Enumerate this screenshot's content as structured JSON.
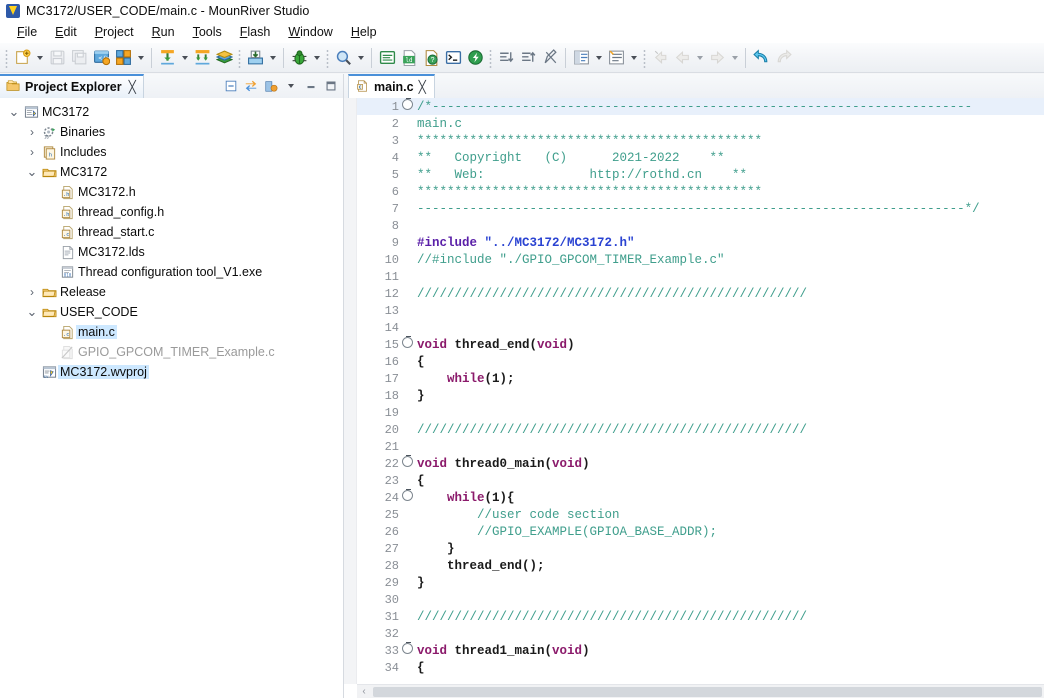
{
  "window": {
    "title": "MC3172/USER_CODE/main.c - MounRiver Studio",
    "logo_icon": "mounriver-logo-icon"
  },
  "menubar": {
    "items": [
      {
        "label": "File",
        "mnemonic": "F"
      },
      {
        "label": "Edit",
        "mnemonic": "E"
      },
      {
        "label": "Project",
        "mnemonic": "P"
      },
      {
        "label": "Run",
        "mnemonic": "R"
      },
      {
        "label": "Tools",
        "mnemonic": "T"
      },
      {
        "label": "Flash",
        "mnemonic": "F"
      },
      {
        "label": "Window",
        "mnemonic": "W"
      },
      {
        "label": "Help",
        "mnemonic": "H"
      }
    ]
  },
  "toolbar": {
    "groups": [
      {
        "buttons": [
          {
            "name": "new-button",
            "icon": "new-file-icon",
            "enabled": true,
            "dropdown": true
          },
          {
            "name": "save-button",
            "icon": "save-icon",
            "enabled": false,
            "dropdown": false
          },
          {
            "name": "save-all-button",
            "icon": "save-all-icon",
            "enabled": false,
            "dropdown": false
          },
          {
            "name": "new-project-button",
            "icon": "new-project-icon",
            "enabled": true,
            "dropdown": false
          },
          {
            "name": "build-configurations-button",
            "icon": "build-config-icon",
            "enabled": true,
            "dropdown": true
          }
        ]
      },
      {
        "buttons": [
          {
            "name": "build-button",
            "icon": "build-hammer-icon",
            "enabled": true,
            "dropdown": true
          },
          {
            "name": "build-all-button",
            "icon": "build-all-icon",
            "enabled": true,
            "dropdown": false
          },
          {
            "name": "library-button",
            "icon": "books-icon",
            "enabled": true,
            "dropdown": false
          }
        ]
      },
      {
        "buttons": [
          {
            "name": "download-button",
            "icon": "download-tray-icon",
            "enabled": true,
            "dropdown": true
          }
        ]
      },
      {
        "buttons": [
          {
            "name": "debug-button",
            "icon": "debug-bug-icon",
            "enabled": true,
            "dropdown": true
          }
        ]
      },
      {
        "buttons": [
          {
            "name": "search-button",
            "icon": "magnifier-icon",
            "enabled": true,
            "dropdown": true
          }
        ]
      },
      {
        "buttons": [
          {
            "name": "console-button",
            "icon": "console-icon",
            "enabled": true,
            "dropdown": false
          },
          {
            "name": "ld-file-button",
            "icon": "ld-file-icon",
            "enabled": true,
            "dropdown": false
          },
          {
            "name": "help-doc-button",
            "icon": "help-doc-icon",
            "enabled": true,
            "dropdown": false
          },
          {
            "name": "terminal-button",
            "icon": "terminal-icon",
            "enabled": true,
            "dropdown": false
          },
          {
            "name": "power-shell-button",
            "icon": "green-power-icon",
            "enabled": true,
            "dropdown": false
          }
        ]
      },
      {
        "buttons": [
          {
            "name": "next-annotation-button",
            "icon": "next-annotation-icon",
            "enabled": true,
            "dropdown": false
          },
          {
            "name": "previous-annotation-button",
            "icon": "previous-annotation-icon",
            "enabled": true,
            "dropdown": false
          },
          {
            "name": "last-edit-location-button",
            "icon": "last-edit-location-icon",
            "enabled": true,
            "dropdown": false
          }
        ]
      },
      {
        "buttons": [
          {
            "name": "outline-button",
            "icon": "outline-list-icon",
            "enabled": true,
            "dropdown": true
          },
          {
            "name": "toggle-mark-occurrences-button",
            "icon": "mark-occurrences-icon",
            "enabled": true,
            "dropdown": true
          }
        ]
      },
      {
        "buttons": [
          {
            "name": "back-button",
            "icon": "back-arrow-icon",
            "enabled": false,
            "dropdown": false
          },
          {
            "name": "forward-back-button",
            "icon": "left-arrow-icon",
            "enabled": false,
            "dropdown": true
          },
          {
            "name": "forward-button",
            "icon": "right-arrow-icon",
            "enabled": false,
            "dropdown": true
          }
        ]
      },
      {
        "buttons": [
          {
            "name": "undo-button",
            "icon": "undo-arrow-icon",
            "enabled": true,
            "dropdown": false
          },
          {
            "name": "redo-button",
            "icon": "redo-arrow-icon",
            "enabled": false,
            "dropdown": false
          }
        ]
      }
    ]
  },
  "project_explorer": {
    "tab_label": "Project Explorer",
    "tab_icon": "project-explorer-icon",
    "close_glyph": "╳",
    "view_buttons": [
      {
        "name": "collapse-all-button",
        "icon": "collapse-all-icon"
      },
      {
        "name": "link-with-editor-button",
        "icon": "link-editor-icon"
      },
      {
        "name": "view-menu-button",
        "icon": "view-filter-icon"
      },
      {
        "name": "view-menu-chevron",
        "icon": "chevron-down-icon"
      },
      {
        "name": "minimize-view-button",
        "icon": "minimize-icon"
      },
      {
        "name": "maximize-view-button",
        "icon": "maximize-icon"
      }
    ],
    "tree": [
      {
        "label": "MC3172",
        "indent": 0,
        "twisty": "expanded",
        "icon": "project-icon",
        "selected": false,
        "dim": false
      },
      {
        "label": "Binaries",
        "indent": 1,
        "twisty": "collapsed",
        "icon": "binaries-icon",
        "selected": false,
        "dim": false
      },
      {
        "label": "Includes",
        "indent": 1,
        "twisty": "collapsed",
        "icon": "includes-icon",
        "selected": false,
        "dim": false
      },
      {
        "label": "MC3172",
        "indent": 1,
        "twisty": "expanded",
        "icon": "folder-icon",
        "selected": false,
        "dim": false
      },
      {
        "label": "MC3172.h",
        "indent": 2,
        "twisty": "none",
        "icon": "header-file-icon",
        "selected": false,
        "dim": false
      },
      {
        "label": "thread_config.h",
        "indent": 2,
        "twisty": "none",
        "icon": "header-file-icon",
        "selected": false,
        "dim": false
      },
      {
        "label": "thread_start.c",
        "indent": 2,
        "twisty": "none",
        "icon": "c-file-icon",
        "selected": false,
        "dim": false
      },
      {
        "label": "MC3172.lds",
        "indent": 2,
        "twisty": "none",
        "icon": "lds-file-icon",
        "selected": false,
        "dim": false
      },
      {
        "label": "Thread configuration tool_V1.exe",
        "indent": 2,
        "twisty": "none",
        "icon": "exe-file-icon",
        "selected": false,
        "dim": false
      },
      {
        "label": "Release",
        "indent": 1,
        "twisty": "collapsed",
        "icon": "folder-icon",
        "selected": false,
        "dim": false
      },
      {
        "label": "USER_CODE",
        "indent": 1,
        "twisty": "expanded",
        "icon": "folder-icon",
        "selected": false,
        "dim": false
      },
      {
        "label": "main.c",
        "indent": 2,
        "twisty": "none",
        "icon": "c-file-icon",
        "selected": true,
        "dim": false
      },
      {
        "label": "GPIO_GPCOM_TIMER_Example.c",
        "indent": 2,
        "twisty": "none",
        "icon": "excluded-file-icon",
        "selected": false,
        "dim": true
      },
      {
        "label": "MC3172.wvproj",
        "indent": 1,
        "twisty": "none",
        "icon": "wvproj-icon",
        "selected": true,
        "dim": false
      }
    ]
  },
  "editor": {
    "tabs": [
      {
        "label": "main.c",
        "icon": "c-file-icon",
        "active": true,
        "close_glyph": "╳"
      }
    ],
    "horizontal_scroll_left_glyph": "‹",
    "lines": [
      {
        "n": 1,
        "fold": true,
        "highlight": true,
        "tokens": [
          {
            "t": "/*------------------------------------------------------------------------",
            "c": "cmt"
          }
        ]
      },
      {
        "n": 2,
        "fold": false,
        "highlight": false,
        "tokens": [
          {
            "t": "main.c",
            "c": "cmt"
          }
        ]
      },
      {
        "n": 3,
        "fold": false,
        "highlight": false,
        "tokens": [
          {
            "t": "**********************************************",
            "c": "cmt"
          }
        ]
      },
      {
        "n": 4,
        "fold": false,
        "highlight": false,
        "tokens": [
          {
            "t": "**   Copyright   (C)      2021-2022    **",
            "c": "cmt"
          }
        ]
      },
      {
        "n": 5,
        "fold": false,
        "highlight": false,
        "tokens": [
          {
            "t": "**   Web:              http://rothd.cn    **",
            "c": "cmt"
          }
        ]
      },
      {
        "n": 6,
        "fold": false,
        "highlight": false,
        "tokens": [
          {
            "t": "**********************************************",
            "c": "cmt"
          }
        ]
      },
      {
        "n": 7,
        "fold": false,
        "highlight": false,
        "tokens": [
          {
            "t": "-------------------------------------------------------------------------*/",
            "c": "cmt"
          }
        ]
      },
      {
        "n": 8,
        "fold": false,
        "highlight": false,
        "tokens": []
      },
      {
        "n": 9,
        "fold": false,
        "highlight": false,
        "tokens": [
          {
            "t": "#include ",
            "c": "pre"
          },
          {
            "t": "\"../MC3172/MC3172.h\"",
            "c": "str"
          }
        ]
      },
      {
        "n": 10,
        "fold": false,
        "highlight": false,
        "tokens": [
          {
            "t": "//#include \"./GPIO_GPCOM_TIMER_Example.c\"",
            "c": "cmt"
          }
        ]
      },
      {
        "n": 11,
        "fold": false,
        "highlight": false,
        "tokens": []
      },
      {
        "n": 12,
        "fold": false,
        "highlight": false,
        "tokens": [
          {
            "t": "////////////////////////////////////////////////////",
            "c": "cmt"
          }
        ]
      },
      {
        "n": 13,
        "fold": false,
        "highlight": false,
        "tokens": []
      },
      {
        "n": 14,
        "fold": false,
        "highlight": false,
        "tokens": []
      },
      {
        "n": 15,
        "fold": true,
        "highlight": false,
        "tokens": [
          {
            "t": "void ",
            "c": "kw"
          },
          {
            "t": "thread_end",
            "c": "plain"
          },
          {
            "t": "(",
            "c": "punct"
          },
          {
            "t": "void",
            "c": "kw"
          },
          {
            "t": ")",
            "c": "punct"
          }
        ]
      },
      {
        "n": 16,
        "fold": false,
        "highlight": false,
        "tokens": [
          {
            "t": "{",
            "c": "punct"
          }
        ]
      },
      {
        "n": 17,
        "fold": false,
        "highlight": false,
        "tokens": [
          {
            "t": "    ",
            "c": "plain"
          },
          {
            "t": "while",
            "c": "kw"
          },
          {
            "t": "(1);",
            "c": "punct"
          }
        ]
      },
      {
        "n": 18,
        "fold": false,
        "highlight": false,
        "tokens": [
          {
            "t": "}",
            "c": "punct"
          }
        ]
      },
      {
        "n": 19,
        "fold": false,
        "highlight": false,
        "tokens": []
      },
      {
        "n": 20,
        "fold": false,
        "highlight": false,
        "tokens": [
          {
            "t": "////////////////////////////////////////////////////",
            "c": "cmt"
          }
        ]
      },
      {
        "n": 21,
        "fold": false,
        "highlight": false,
        "tokens": []
      },
      {
        "n": 22,
        "fold": true,
        "highlight": false,
        "tokens": [
          {
            "t": "void ",
            "c": "kw"
          },
          {
            "t": "thread0_main",
            "c": "plain"
          },
          {
            "t": "(",
            "c": "punct"
          },
          {
            "t": "void",
            "c": "kw"
          },
          {
            "t": ")",
            "c": "punct"
          }
        ]
      },
      {
        "n": 23,
        "fold": false,
        "highlight": false,
        "tokens": [
          {
            "t": "{",
            "c": "punct"
          }
        ]
      },
      {
        "n": 24,
        "fold": true,
        "highlight": false,
        "tokens": [
          {
            "t": "    ",
            "c": "plain"
          },
          {
            "t": "while",
            "c": "kw"
          },
          {
            "t": "(1){",
            "c": "punct"
          }
        ]
      },
      {
        "n": 25,
        "fold": false,
        "highlight": false,
        "tokens": [
          {
            "t": "        ",
            "c": "plain"
          },
          {
            "t": "//user code section",
            "c": "cmt"
          }
        ]
      },
      {
        "n": 26,
        "fold": false,
        "highlight": false,
        "tokens": [
          {
            "t": "        ",
            "c": "plain"
          },
          {
            "t": "//GPIO_EXAMPLE(GPIOA_BASE_ADDR);",
            "c": "cmt"
          }
        ]
      },
      {
        "n": 27,
        "fold": false,
        "highlight": false,
        "tokens": [
          {
            "t": "    }",
            "c": "punct"
          }
        ]
      },
      {
        "n": 28,
        "fold": false,
        "highlight": false,
        "tokens": [
          {
            "t": "    ",
            "c": "plain"
          },
          {
            "t": "thread_end",
            "c": "plain"
          },
          {
            "t": "();",
            "c": "punct"
          }
        ]
      },
      {
        "n": 29,
        "fold": false,
        "highlight": false,
        "tokens": [
          {
            "t": "}",
            "c": "punct"
          }
        ]
      },
      {
        "n": 30,
        "fold": false,
        "highlight": false,
        "tokens": []
      },
      {
        "n": 31,
        "fold": false,
        "highlight": false,
        "tokens": [
          {
            "t": "////////////////////////////////////////////////////",
            "c": "cmt"
          }
        ]
      },
      {
        "n": 32,
        "fold": false,
        "highlight": false,
        "tokens": []
      },
      {
        "n": 33,
        "fold": true,
        "highlight": false,
        "tokens": [
          {
            "t": "void ",
            "c": "kw"
          },
          {
            "t": "thread1_main",
            "c": "plain"
          },
          {
            "t": "(",
            "c": "punct"
          },
          {
            "t": "void",
            "c": "kw"
          },
          {
            "t": ")",
            "c": "punct"
          }
        ]
      },
      {
        "n": 34,
        "fold": false,
        "highlight": false,
        "tokens": [
          {
            "t": "{",
            "c": "punct"
          }
        ]
      }
    ]
  },
  "colors": {
    "accent_tab": "#4a90d9",
    "selection": "#cde8ff",
    "comment": "#3f9e8c",
    "keyword": "#8b1a6b",
    "preprocessor": "#5a1fa8",
    "string": "#2a43d2",
    "current_line": "#e8f0fb"
  }
}
